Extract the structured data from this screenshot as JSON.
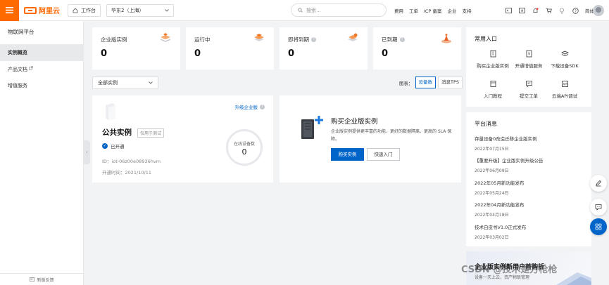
{
  "brand": {
    "name": "阿里云",
    "accent": "#ff6a00",
    "primary": "#0064c8"
  },
  "topbar": {
    "workbench": "工作台",
    "region": "华东2（上海）",
    "search_placeholder": "搜索...",
    "nav": [
      "费用",
      "工单",
      "ICP 备案",
      "企业",
      "支持"
    ],
    "lang": "简体",
    "icons": [
      "terminal-icon",
      "download-icon",
      "bell-icon",
      "cart-icon",
      "bulb-icon",
      "help-icon"
    ]
  },
  "sidebar": {
    "title": "物联网平台",
    "items": [
      {
        "label": "实例概览",
        "active": true
      },
      {
        "label": "产品文档",
        "external": true
      },
      {
        "label": "增值服务"
      }
    ],
    "footer": "新版反馈"
  },
  "stats": [
    {
      "label": "企业版实例",
      "value": "0",
      "help": false
    },
    {
      "label": "运行中",
      "value": "0",
      "help": false
    },
    {
      "label": "即将到期",
      "value": "0",
      "help": true
    },
    {
      "label": "已到期",
      "value": "0",
      "help": true
    }
  ],
  "filter": {
    "instance_select": "全部实例",
    "chart_label": "图表：",
    "toggles": [
      {
        "label": "设备数",
        "active": true
      },
      {
        "label": "消息TPS",
        "active": false
      }
    ]
  },
  "public_instance": {
    "upgrade_link": "升级企业版",
    "title": "公共实例",
    "tag": "仅用于测试",
    "status": "已开通",
    "id_line": "ID：iot-06z00e08936hvm",
    "opened_line": "开通时间：2021/10/11",
    "online_label": "在线设备数",
    "online_value": "0"
  },
  "buy_enterprise": {
    "title": "购买企业版实例",
    "desc": "企业版实例提供更丰富的功能、更好的数据隔离、更高的 SLA 保障。",
    "buy_button": "购买实例",
    "quickstart_button": "快速入门"
  },
  "quick_entry": {
    "title": "常用入口",
    "items": [
      {
        "label": "购买企业版实例",
        "icon": "building-icon"
      },
      {
        "label": "开通增值服务",
        "icon": "coupon-icon"
      },
      {
        "label": "下载设备SDK",
        "icon": "layers-icon"
      },
      {
        "label": "入门教程",
        "icon": "book-icon"
      },
      {
        "label": "提交工单",
        "icon": "ticket-icon"
      },
      {
        "label": "云端API调试",
        "icon": "api-icon"
      }
    ]
  },
  "news": {
    "title": "平台消息",
    "items": [
      {
        "title": "存量设备0改造迁移企业版实例",
        "date": "2022年07月15日"
      },
      {
        "title": "【重要升级】企业版实例升级公告",
        "date": "2022年06月09日"
      },
      {
        "title": "2022年05月新功能发布",
        "date": "2022年05月24日"
      },
      {
        "title": "2022年04月新功能发布",
        "date": "2022年04月18日"
      },
      {
        "title": "技术白皮书V1.0正式发布",
        "date": "2022年03月02日"
      }
    ]
  },
  "promo": {
    "title": "企业版实例新用户首购折",
    "subtitle": "设备一天上云，资产物联管理"
  },
  "watermark": "CSDN @技术是方枪枪"
}
